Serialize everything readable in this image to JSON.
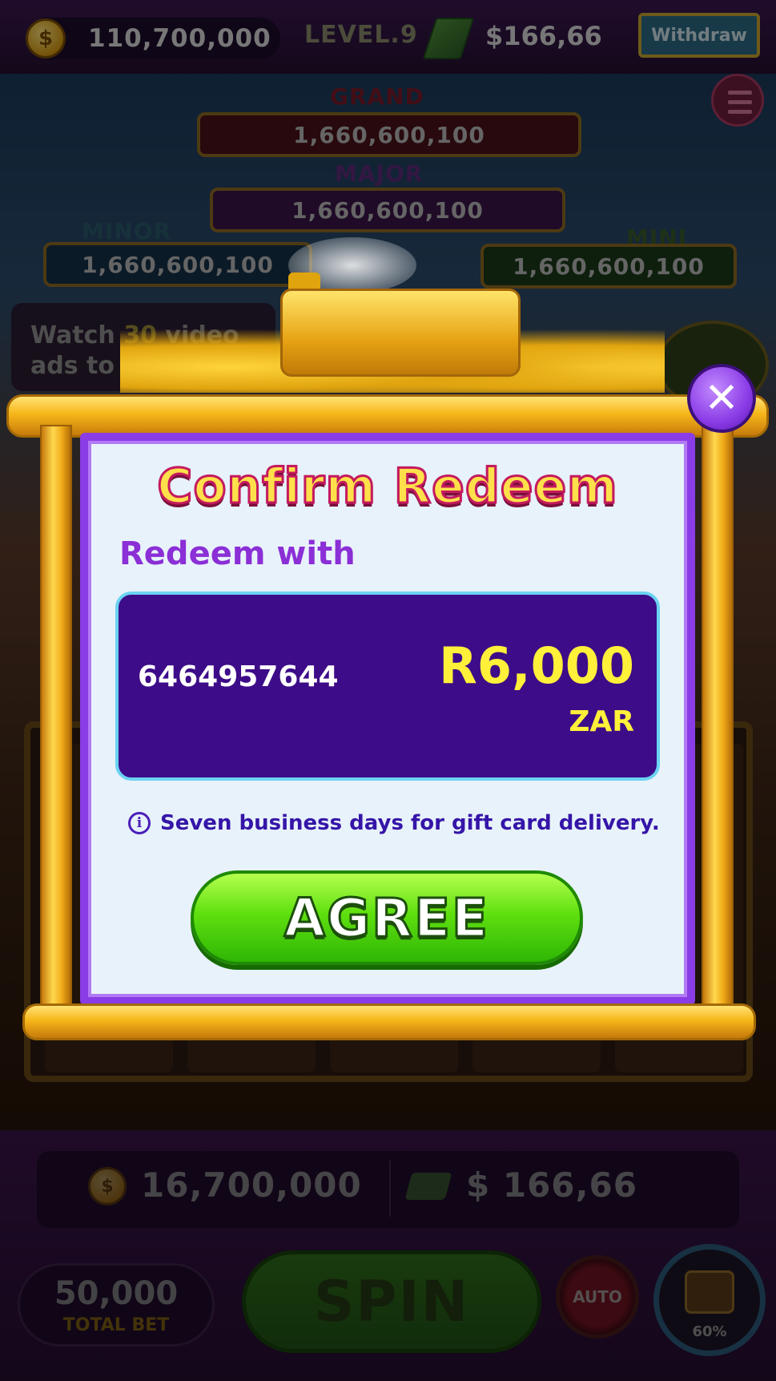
{
  "header": {
    "coins": "110,700,000",
    "level": "LEVEL.9",
    "cash": "$166,66",
    "withdraw_label": "Withdraw"
  },
  "jackpots": {
    "grand": {
      "label": "GRAND",
      "value": "1,660,600,100"
    },
    "major": {
      "label": "MAJOR",
      "value": "1,660,600,100"
    },
    "minor": {
      "label": "MINOR",
      "value": "1,660,600,100"
    },
    "mini": {
      "label": "MINI",
      "value": "1,660,600,100"
    }
  },
  "watch_ads": {
    "prefix": "Watch ",
    "count": "30",
    "suffix": " video",
    "line2": "ads to withdraw"
  },
  "bottom": {
    "win_coins": "16,700,000",
    "win_cash": "$ 166,66",
    "total_bet": "50,000",
    "total_bet_label": "TOTAL BET",
    "spin_label": "SPIN",
    "auto_label": "AUTO",
    "chest_progress": "60%"
  },
  "modal": {
    "title": "Confirm Redeem",
    "redeem_with_label": "Redeem with",
    "account_number": "6464957644",
    "amount": "R6,000",
    "currency": "ZAR",
    "info_text": "Seven business days for gift card delivery.",
    "agree_label": "AGREE",
    "close_symbol": "✕"
  },
  "colors": {
    "title_fill": "#ffe04a",
    "card_border": "#8a3ce6",
    "account_bg": "#3d0c88",
    "amount_color": "#fff03a",
    "agree_green": "#5fe00f"
  }
}
